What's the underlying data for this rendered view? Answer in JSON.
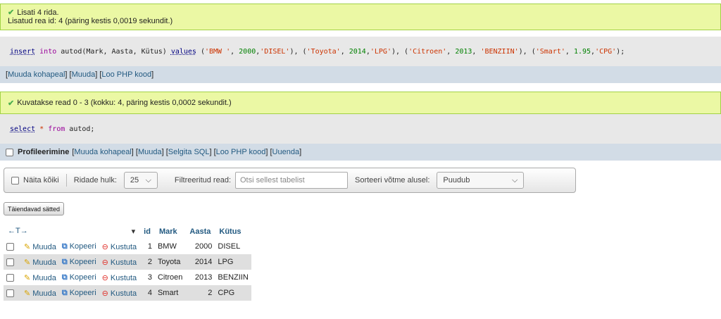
{
  "insert_result": {
    "title": "Lisati 4 rida.",
    "subtitle": "Lisatud rea id: 4 (päring kestis 0,0019 sekundit.)"
  },
  "insert_sql": {
    "tokens": [
      {
        "t": "insert",
        "c": "fn"
      },
      {
        "t": " "
      },
      {
        "t": "into",
        "c": "kw"
      },
      {
        "t": " autod(Mark, Aasta, Kütus) "
      },
      {
        "t": "values",
        "c": "fn"
      },
      {
        "t": " ("
      },
      {
        "t": "'BMW '",
        "c": "str"
      },
      {
        "t": ", "
      },
      {
        "t": "2000",
        "c": "num"
      },
      {
        "t": ","
      },
      {
        "t": "'DISEL'",
        "c": "str"
      },
      {
        "t": "), ("
      },
      {
        "t": "'Toyota'",
        "c": "str"
      },
      {
        "t": ", "
      },
      {
        "t": "2014",
        "c": "num"
      },
      {
        "t": ","
      },
      {
        "t": "'LPG'",
        "c": "str"
      },
      {
        "t": "), ("
      },
      {
        "t": "'Citroen'",
        "c": "str"
      },
      {
        "t": ", "
      },
      {
        "t": "2013",
        "c": "num"
      },
      {
        "t": ", "
      },
      {
        "t": "'BENZIIN'",
        "c": "str"
      },
      {
        "t": "), ("
      },
      {
        "t": "'Smart'",
        "c": "str"
      },
      {
        "t": ", "
      },
      {
        "t": "1.95",
        "c": "num"
      },
      {
        "t": ","
      },
      {
        "t": "'CPG'",
        "c": "str"
      },
      {
        "t": ");"
      }
    ]
  },
  "insert_links": {
    "open": "[",
    "edit_inline": "Muuda kohapeal",
    "mid1": "] [",
    "edit": "Muuda",
    "mid2": "] [",
    "php": "Loo PHP kood",
    "close": "]"
  },
  "select_result": {
    "title": "Kuvatakse read 0 - 3 (kokku: 4, päring kestis 0,0002 sekundit.)"
  },
  "select_sql": {
    "kw_select": "select",
    "star": " * ",
    "kw_from": "from",
    "table": " autod;"
  },
  "select_links": {
    "profiling": "Profileerimine",
    "open": "[",
    "edit_inline": "Muuda kohapeal",
    "sep": "] [",
    "edit": "Muuda",
    "explain": "Selgita SQL",
    "php": "Loo PHP kood",
    "refresh": "Uuenda",
    "close": "]"
  },
  "navbar": {
    "show_all": "Näita kõiki",
    "rows_label": "Ridade hulk:",
    "rows_value": "25",
    "filter_label": "Filtreeritud read:",
    "filter_placeholder": "Otsi sellest tabelist",
    "sort_label": "Sorteeri võtme alusel:",
    "sort_value": "Puudub"
  },
  "extra_options_button": "Täiendavad sätted",
  "table": {
    "arrows": "←T→",
    "sort_icon": "▾",
    "columns": [
      "id",
      "Mark",
      "Aasta",
      "Kütus"
    ],
    "actions": {
      "edit": "Muuda",
      "copy": "Kopeeri",
      "delete": "Kustuta"
    },
    "rows": [
      {
        "id": "1",
        "mark": "BMW",
        "aasta": "2000",
        "kytus": "DISEL"
      },
      {
        "id": "2",
        "mark": "Toyota",
        "aasta": "2014",
        "kytus": "LPG"
      },
      {
        "id": "3",
        "mark": "Citroen",
        "aasta": "2013",
        "kytus": "BENZIIN"
      },
      {
        "id": "4",
        "mark": "Smart",
        "aasta": "2",
        "kytus": "CPG"
      }
    ]
  },
  "colors": {
    "success_bg": "#ebf8a4",
    "link": "#235a81",
    "sql_bg": "#e8e8e8",
    "links_bg": "#d2dce6"
  }
}
